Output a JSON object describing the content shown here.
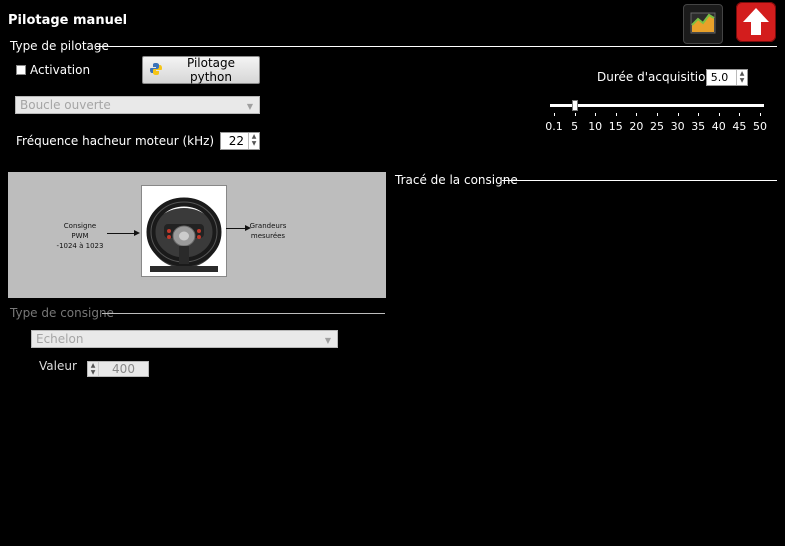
{
  "header": {
    "title": "Pilotage manuel",
    "icons": {
      "chart": "chart-icon",
      "exit": "exit-arrow-icon"
    }
  },
  "pilotage": {
    "group_label": "Type de pilotage",
    "activation_label": "Activation",
    "activation_checked": false,
    "python_button_label": "Pilotage python",
    "mode_value": "Boucle ouverte",
    "freq_label": "Fréquence hacheur moteur (kHz)",
    "freq_value": "22"
  },
  "acquisition": {
    "label": "Durée d'acquisition",
    "value": "5.0",
    "slider_value": 5,
    "ticks": [
      "0.1",
      "5",
      "10",
      "15",
      "20",
      "25",
      "30",
      "35",
      "40",
      "45",
      "50"
    ]
  },
  "diagram": {
    "input_label": [
      "Consigne",
      "PWM",
      "-1024 à 1023"
    ],
    "output_label": [
      "Grandeurs",
      "mesurées"
    ]
  },
  "trace": {
    "group_label": "Tracé de la consigne"
  },
  "consigne": {
    "group_label": "Type de consigne",
    "type_value": "Echelon",
    "valeur_label": "Valeur",
    "valeur_value": "400"
  },
  "colors": {
    "background": "#000000",
    "exit_red": "#d31d1d",
    "diagram_bg": "#bdbdbd",
    "disabled_field": "#e9e9e9"
  }
}
